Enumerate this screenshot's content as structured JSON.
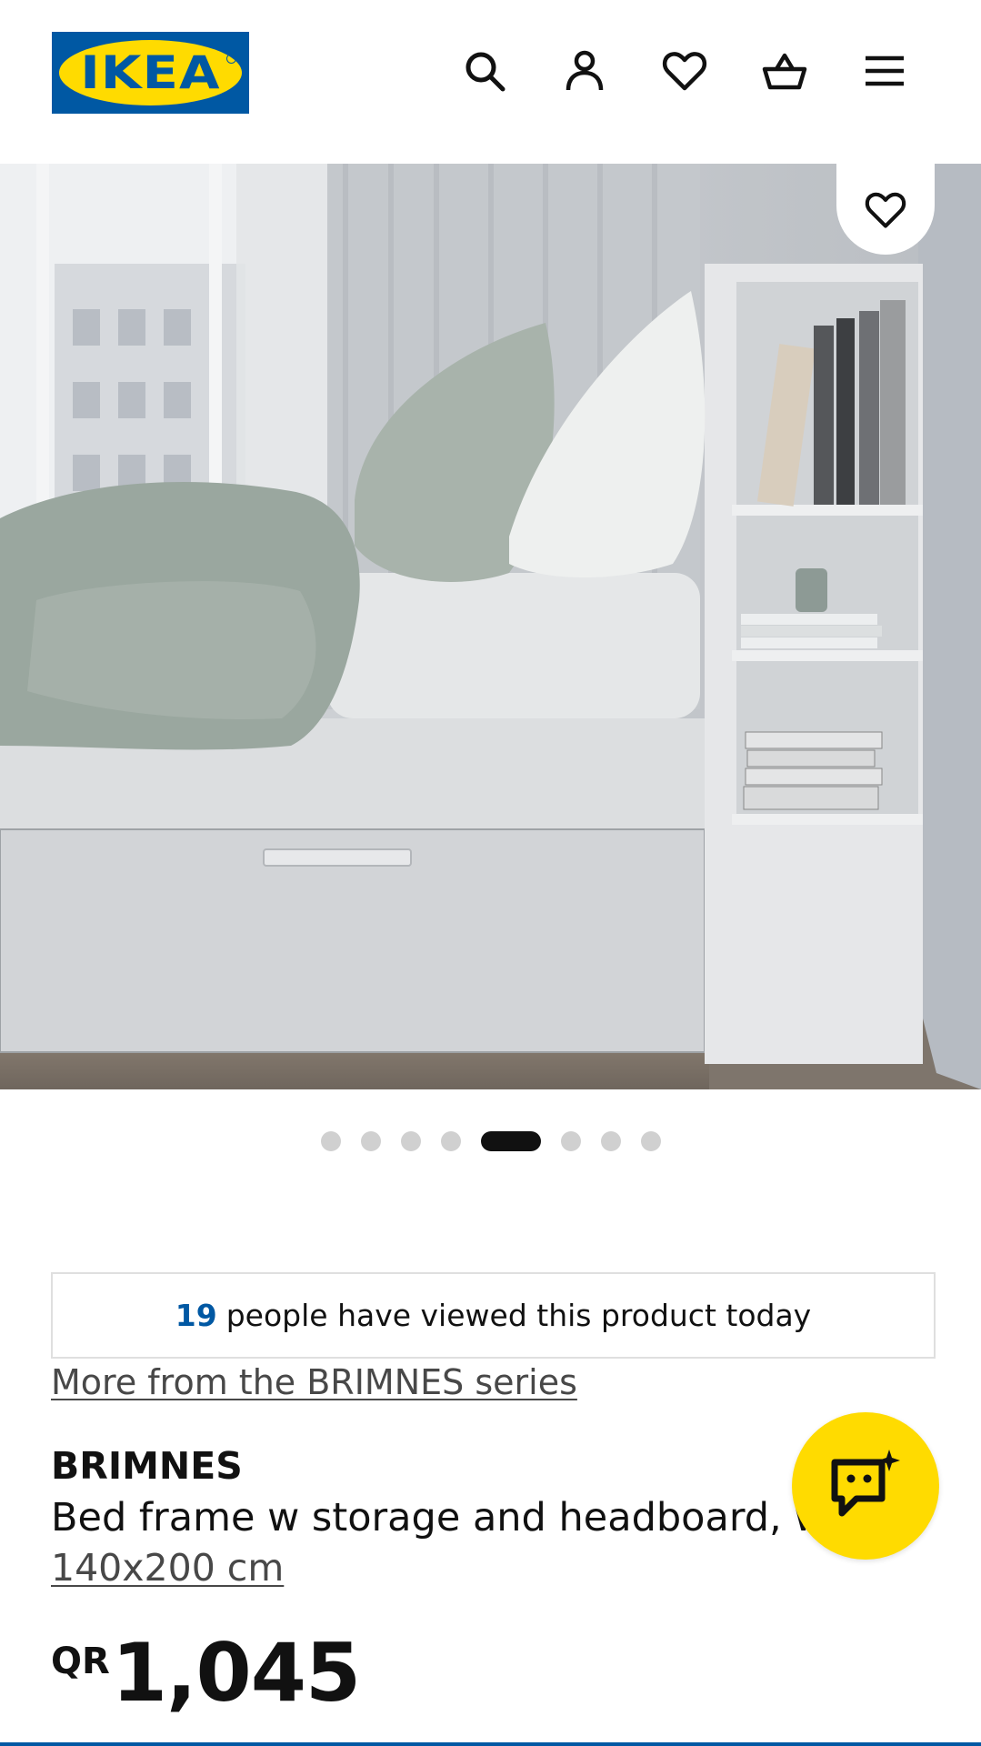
{
  "header": {
    "logo_text": "IKEA",
    "icons": [
      "search-icon",
      "account-icon",
      "heart-icon",
      "basket-icon",
      "menu-icon"
    ]
  },
  "hero": {
    "favourite_icon": "heart-icon",
    "carousel": {
      "total": 8,
      "active_index": 4
    }
  },
  "viewed_notice": {
    "count": "19",
    "text": "people have viewed this product today"
  },
  "series_link": "More from the BRIMNES series",
  "product": {
    "name": "BRIMNES",
    "description": "Bed frame w storage and headboard, white",
    "size": "140x200 cm",
    "price_currency": "QR",
    "price_amount": "1,045"
  },
  "chat_button_icon": "chat-sparkle-icon",
  "colors": {
    "ikea_blue": "#0058a3",
    "ikea_yellow": "#ffdb00"
  }
}
